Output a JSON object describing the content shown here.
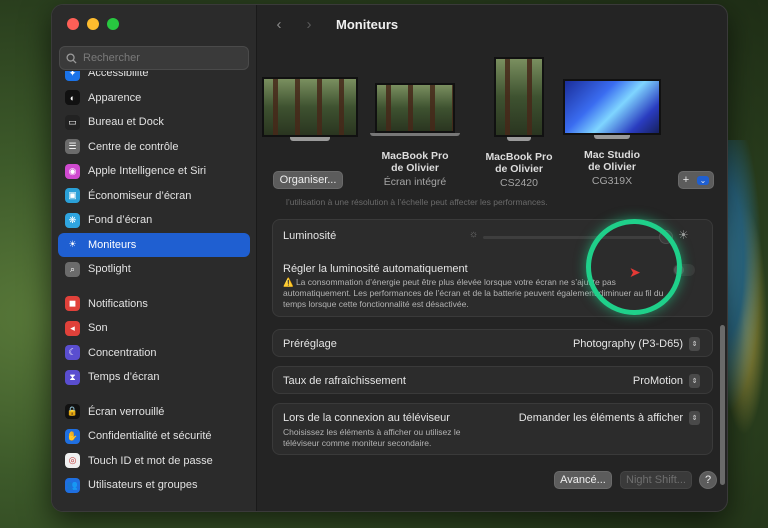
{
  "window": {
    "title": "Moniteurs"
  },
  "search": {
    "placeholder": "Rechercher"
  },
  "sidebar": {
    "items": [
      {
        "label": "Accessibilité",
        "icon": "accessibility-icon",
        "color": "#1b73e8",
        "glyph": "✦"
      },
      {
        "label": "Apparence",
        "icon": "appearance-icon",
        "color": "#111111",
        "glyph": "◐"
      },
      {
        "label": "Bureau et Dock",
        "icon": "desktop-dock-icon",
        "color": "#222222",
        "glyph": "▭"
      },
      {
        "label": "Centre de contrôle",
        "icon": "control-center-icon",
        "color": "#6b6b6b",
        "glyph": "☰"
      },
      {
        "label": "Apple Intelligence et Siri",
        "icon": "siri-icon",
        "color": "#d04ad0",
        "glyph": "◉"
      },
      {
        "label": "Économiseur d’écran",
        "icon": "screensaver-icon",
        "color": "#2aa0d8",
        "glyph": "▣"
      },
      {
        "label": "Fond d’écran",
        "icon": "wallpaper-icon",
        "color": "#2fa5e0",
        "glyph": "❋"
      },
      {
        "label": "Moniteurs",
        "icon": "displays-icon",
        "color": "#1f5fd1",
        "glyph": "☀",
        "active": true
      },
      {
        "label": "Spotlight",
        "icon": "spotlight-icon",
        "color": "#6b6b6b",
        "glyph": "⌕"
      },
      {
        "label": "Notifications",
        "icon": "notifications-icon",
        "color": "#e0413a",
        "glyph": "◼"
      },
      {
        "label": "Son",
        "icon": "sound-icon",
        "color": "#e0413a",
        "glyph": "◂"
      },
      {
        "label": "Concentration",
        "icon": "focus-icon",
        "color": "#5a4ed0",
        "glyph": "☾"
      },
      {
        "label": "Temps d’écran",
        "icon": "screen-time-icon",
        "color": "#5a4ed0",
        "glyph": "⧗"
      },
      {
        "label": "Écran verrouillé",
        "icon": "lock-screen-icon",
        "color": "#111111",
        "glyph": "🔒"
      },
      {
        "label": "Confidentialité et sécurité",
        "icon": "privacy-icon",
        "color": "#1f6fe0",
        "glyph": "✋"
      },
      {
        "label": "Touch ID et mot de passe",
        "icon": "touch-id-icon",
        "color": "#f0f0f0",
        "glyph": "◎"
      },
      {
        "label": "Utilisateurs et groupes",
        "icon": "users-icon",
        "color": "#1f6fe0",
        "glyph": "👥"
      }
    ]
  },
  "displays": [
    {
      "name_line1": "",
      "name_line2": "",
      "sub": ""
    },
    {
      "name_line1": "MacBook Pro",
      "name_line2": "de Olivier",
      "sub": "Écran intégré"
    },
    {
      "name_line1": "MacBook Pro",
      "name_line2": "de Olivier",
      "sub": "CS2420"
    },
    {
      "name_line1": "Mac Studio",
      "name_line2": "de Olivier",
      "sub": "CG319X"
    }
  ],
  "buttons": {
    "arrange": "Organiser...",
    "add": "+",
    "advanced": "Avancé...",
    "night_shift": "Night Shift...",
    "help": "?"
  },
  "cut_text": "l’utilisation à une résolution à l’échelle peut affecter les performances.",
  "brightness": {
    "label": "Luminosité",
    "value": 1.0
  },
  "auto_brightness": {
    "label": "Régler la luminosité automatiquement",
    "note": "⚠️ La consommation d’énergie peut être plus élevée lorsque votre écran ne s’ajuste pas automatiquement. Les performances de l’écran et de la batterie peuvent également diminuer au fil du temps lorsque cette fonctionnalité est désactivée.",
    "enabled": false
  },
  "preset": {
    "label": "Préréglage",
    "value": "Photography (P3-D65)"
  },
  "refresh": {
    "label": "Taux de rafraîchissement",
    "value": "ProMotion"
  },
  "tv": {
    "label": "Lors de la connexion au téléviseur",
    "value": "Demander les éléments à afficher",
    "note": "Choisissez les éléments à afficher ou utilisez le téléviseur comme moniteur secondaire."
  }
}
